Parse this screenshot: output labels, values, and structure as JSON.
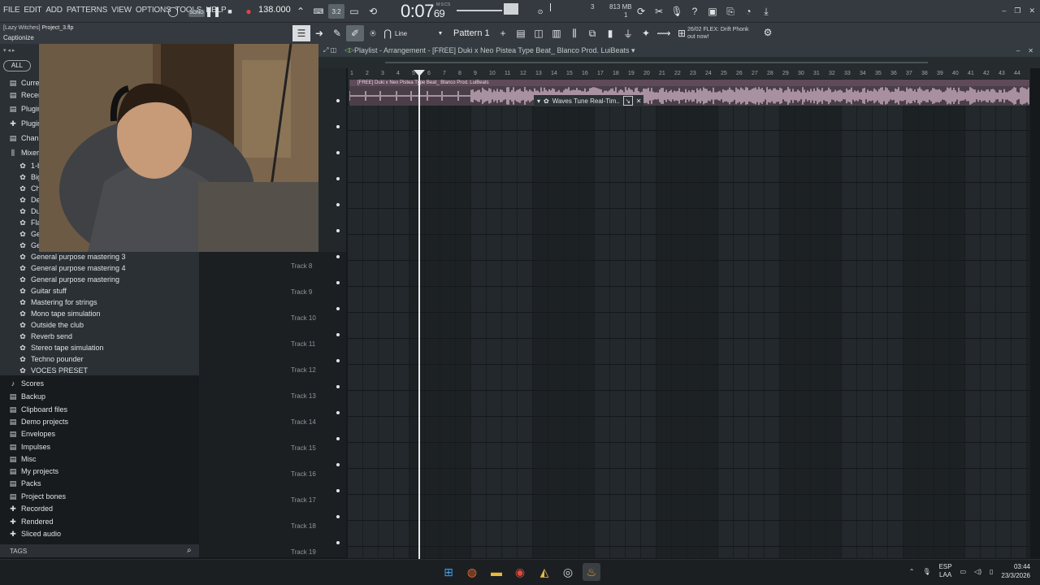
{
  "menu": [
    "FILE",
    "EDIT",
    "ADD",
    "PATTERNS",
    "VIEW",
    "OPTIONS",
    "TOOLS",
    "HELP"
  ],
  "transport": {
    "song_badge": "SONG",
    "tempo": "138.000",
    "time_main": "0:07",
    "time_sub": "69",
    "time_caption": "M:S:CS"
  },
  "meters": {
    "cpu": "3",
    "memory": "813 MB",
    "poly": "1"
  },
  "project": {
    "title_prefix": "[Lazy Witches]",
    "file": "Project_3.flp",
    "hint": "Captionize"
  },
  "toolbar2": {
    "snap": "Line",
    "pattern": "Pattern 1"
  },
  "news": {
    "date": "26/02",
    "headline": "FLEX: Drift Phonk",
    "sub": "out now!"
  },
  "browser": {
    "all_label": "ALL",
    "top_items": [
      {
        "icon": "folder-icon",
        "label": "Curre"
      },
      {
        "icon": "folder-icon",
        "label": "Recen"
      },
      {
        "icon": "folder-icon",
        "label": "Plugin"
      },
      {
        "icon": "plug-icon",
        "label": "Plugin"
      },
      {
        "icon": "folder-icon",
        "label": "Chann"
      },
      {
        "icon": "mixer-icon",
        "label": "Mixer"
      }
    ],
    "mixer_presets_partial": [
      "1-b",
      "Big",
      "Cho",
      "Def",
      "Dua",
      "Flan",
      "Ger",
      "Ger"
    ],
    "mixer_presets": [
      "General purpose mastering 3",
      "General purpose mastering 4",
      "General purpose mastering",
      "Guitar stuff",
      "Mastering for strings",
      "Mono tape simulation",
      "Outside the club",
      "Reverb send",
      "Stereo tape simulation",
      "Techno pounder",
      "VOCES PRESET"
    ],
    "folders": [
      {
        "icon": "note-icon",
        "label": "Scores"
      },
      {
        "icon": "folder-icon",
        "label": "Backup"
      },
      {
        "icon": "folder-icon",
        "label": "Clipboard files"
      },
      {
        "icon": "folder-icon",
        "label": "Demo projects"
      },
      {
        "icon": "folder-icon",
        "label": "Envelopes"
      },
      {
        "icon": "folder-icon",
        "label": "Impulses"
      },
      {
        "icon": "folder-icon",
        "label": "Misc"
      },
      {
        "icon": "folder-icon",
        "label": "My projects"
      },
      {
        "icon": "folder-icon",
        "label": "Packs"
      },
      {
        "icon": "folder-icon",
        "label": "Project bones"
      },
      {
        "icon": "plus-icon",
        "label": "Recorded"
      },
      {
        "icon": "plus-icon",
        "label": "Rendered"
      },
      {
        "icon": "plus-icon",
        "label": "Sliced audio"
      }
    ],
    "tags_label": "TAGS"
  },
  "playlist": {
    "title": "Playlist - Arrangement",
    "arrangement": "[FREE] Duki x Neo Pistea Type Beat_ Blanco  Prod. LuiBeats",
    "clip_label": "[FREE] Duki x Neo Pistea Type Beat_ Blanco  Prod. LuiBeats",
    "bars": [
      "1",
      "2",
      "3",
      "4",
      "5",
      "6",
      "7",
      "8",
      "9",
      "10",
      "11",
      "12",
      "13",
      "14",
      "15",
      "16",
      "17",
      "18",
      "19",
      "20",
      "21",
      "22",
      "23",
      "24",
      "25",
      "26",
      "27",
      "28",
      "29",
      "30",
      "31",
      "32",
      "33",
      "34",
      "35",
      "36",
      "37",
      "38",
      "39",
      "40",
      "41",
      "42",
      "43",
      "44"
    ],
    "popup_label": "Waves Tune Real-Tim..",
    "tracks": [
      "Track 8",
      "Track 9",
      "Track 10",
      "Track 11",
      "Track 12",
      "Track 13",
      "Track 14",
      "Track 15",
      "Track 16",
      "Track 17",
      "Track 18",
      "Track 19"
    ]
  },
  "tray": {
    "lang_top": "ESP",
    "lang_bottom": "LAA",
    "time": "03:44",
    "date": "23/3/2026"
  },
  "colors": {
    "accent_clip": "#5e4a59",
    "waveform": "#e7c8dc"
  }
}
